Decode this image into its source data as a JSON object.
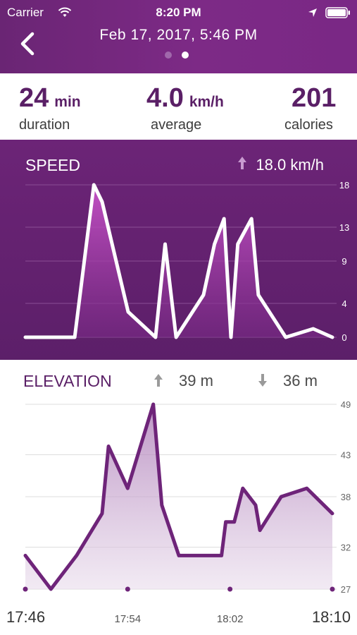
{
  "status_bar": {
    "carrier": "Carrier",
    "time": "8:20 PM"
  },
  "header": {
    "title": "Feb 17, 2017, 5:46 PM",
    "page_dots": 2,
    "active_dot": 1
  },
  "stats": {
    "duration_value": "24",
    "duration_unit": "min",
    "duration_label": "duration",
    "average_value": "4.0",
    "average_unit": "km/h",
    "average_label": "average",
    "calories_value": "201",
    "calories_label": "calories"
  },
  "speed": {
    "title": "SPEED",
    "max_label": "18.0 km/h"
  },
  "elevation": {
    "title": "ELEVATION",
    "gain_label": "39 m",
    "loss_label": "36 m"
  },
  "colors": {
    "accent": "#6e2479",
    "header": "#7a2885",
    "line_white": "#ffffff"
  },
  "chart_data": [
    {
      "type": "area",
      "title": "SPEED",
      "ylabel": "km/h",
      "yticks": [
        "18",
        "13",
        "9",
        "4",
        "0"
      ],
      "ylim": [
        0,
        18
      ],
      "points": [
        {
          "x": 0.0,
          "y": 0
        },
        {
          "x": 3.6,
          "y": 0
        },
        {
          "x": 5.0,
          "y": 18.0
        },
        {
          "x": 5.6,
          "y": 16.0
        },
        {
          "x": 7.5,
          "y": 3.0
        },
        {
          "x": 9.5,
          "y": 0
        },
        {
          "x": 10.2,
          "y": 11.0
        },
        {
          "x": 11.0,
          "y": 0
        },
        {
          "x": 13.0,
          "y": 5.0
        },
        {
          "x": 13.8,
          "y": 11.0
        },
        {
          "x": 14.5,
          "y": 14.0
        },
        {
          "x": 15.0,
          "y": 0
        },
        {
          "x": 15.5,
          "y": 11.0
        },
        {
          "x": 16.5,
          "y": 14.0
        },
        {
          "x": 17.0,
          "y": 5.0
        },
        {
          "x": 19.0,
          "y": 0
        },
        {
          "x": 21.0,
          "y": 1.0
        },
        {
          "x": 22.4,
          "y": 0
        }
      ]
    },
    {
      "type": "area",
      "title": "ELEVATION",
      "ylabel": "m",
      "yticks": [
        "49",
        "43",
        "38",
        "32",
        "27"
      ],
      "ylim": [
        27,
        49
      ],
      "xticks": [
        "17:46",
        "17:54",
        "18:02",
        "18:10"
      ],
      "points": [
        {
          "x": "17:46",
          "y": 31
        },
        {
          "x": "17:48",
          "y": 27
        },
        {
          "x": "17:50",
          "y": 31
        },
        {
          "x": "17:52",
          "y": 36
        },
        {
          "x": "17:52:30",
          "y": 44
        },
        {
          "x": "17:54",
          "y": 39
        },
        {
          "x": "17:56",
          "y": 49
        },
        {
          "x": "17:56:40",
          "y": 37
        },
        {
          "x": "17:58",
          "y": 31
        },
        {
          "x": "18:00",
          "y": 31
        },
        {
          "x": "18:01:20",
          "y": 31
        },
        {
          "x": "18:01:40",
          "y": 35
        },
        {
          "x": "18:02:20",
          "y": 35
        },
        {
          "x": "18:03",
          "y": 39
        },
        {
          "x": "18:04",
          "y": 37
        },
        {
          "x": "18:04:20",
          "y": 34
        },
        {
          "x": "18:06",
          "y": 38
        },
        {
          "x": "18:08",
          "y": 39
        },
        {
          "x": "18:10",
          "y": 36
        }
      ]
    }
  ]
}
